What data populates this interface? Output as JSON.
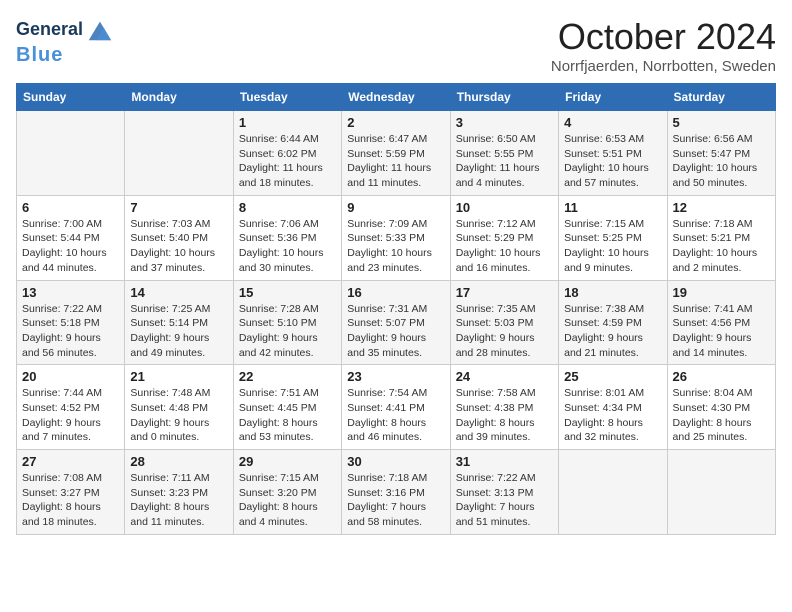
{
  "header": {
    "logo_line1": "General",
    "logo_line2": "Blue",
    "month": "October 2024",
    "location": "Norrfjaerden, Norrbotten, Sweden"
  },
  "weekdays": [
    "Sunday",
    "Monday",
    "Tuesday",
    "Wednesday",
    "Thursday",
    "Friday",
    "Saturday"
  ],
  "weeks": [
    [
      {
        "day": "",
        "info": ""
      },
      {
        "day": "",
        "info": ""
      },
      {
        "day": "1",
        "info": "Sunrise: 6:44 AM\nSunset: 6:02 PM\nDaylight: 11 hours and 18 minutes."
      },
      {
        "day": "2",
        "info": "Sunrise: 6:47 AM\nSunset: 5:59 PM\nDaylight: 11 hours and 11 minutes."
      },
      {
        "day": "3",
        "info": "Sunrise: 6:50 AM\nSunset: 5:55 PM\nDaylight: 11 hours and 4 minutes."
      },
      {
        "day": "4",
        "info": "Sunrise: 6:53 AM\nSunset: 5:51 PM\nDaylight: 10 hours and 57 minutes."
      },
      {
        "day": "5",
        "info": "Sunrise: 6:56 AM\nSunset: 5:47 PM\nDaylight: 10 hours and 50 minutes."
      }
    ],
    [
      {
        "day": "6",
        "info": "Sunrise: 7:00 AM\nSunset: 5:44 PM\nDaylight: 10 hours and 44 minutes."
      },
      {
        "day": "7",
        "info": "Sunrise: 7:03 AM\nSunset: 5:40 PM\nDaylight: 10 hours and 37 minutes."
      },
      {
        "day": "8",
        "info": "Sunrise: 7:06 AM\nSunset: 5:36 PM\nDaylight: 10 hours and 30 minutes."
      },
      {
        "day": "9",
        "info": "Sunrise: 7:09 AM\nSunset: 5:33 PM\nDaylight: 10 hours and 23 minutes."
      },
      {
        "day": "10",
        "info": "Sunrise: 7:12 AM\nSunset: 5:29 PM\nDaylight: 10 hours and 16 minutes."
      },
      {
        "day": "11",
        "info": "Sunrise: 7:15 AM\nSunset: 5:25 PM\nDaylight: 10 hours and 9 minutes."
      },
      {
        "day": "12",
        "info": "Sunrise: 7:18 AM\nSunset: 5:21 PM\nDaylight: 10 hours and 2 minutes."
      }
    ],
    [
      {
        "day": "13",
        "info": "Sunrise: 7:22 AM\nSunset: 5:18 PM\nDaylight: 9 hours and 56 minutes."
      },
      {
        "day": "14",
        "info": "Sunrise: 7:25 AM\nSunset: 5:14 PM\nDaylight: 9 hours and 49 minutes."
      },
      {
        "day": "15",
        "info": "Sunrise: 7:28 AM\nSunset: 5:10 PM\nDaylight: 9 hours and 42 minutes."
      },
      {
        "day": "16",
        "info": "Sunrise: 7:31 AM\nSunset: 5:07 PM\nDaylight: 9 hours and 35 minutes."
      },
      {
        "day": "17",
        "info": "Sunrise: 7:35 AM\nSunset: 5:03 PM\nDaylight: 9 hours and 28 minutes."
      },
      {
        "day": "18",
        "info": "Sunrise: 7:38 AM\nSunset: 4:59 PM\nDaylight: 9 hours and 21 minutes."
      },
      {
        "day": "19",
        "info": "Sunrise: 7:41 AM\nSunset: 4:56 PM\nDaylight: 9 hours and 14 minutes."
      }
    ],
    [
      {
        "day": "20",
        "info": "Sunrise: 7:44 AM\nSunset: 4:52 PM\nDaylight: 9 hours and 7 minutes."
      },
      {
        "day": "21",
        "info": "Sunrise: 7:48 AM\nSunset: 4:48 PM\nDaylight: 9 hours and 0 minutes."
      },
      {
        "day": "22",
        "info": "Sunrise: 7:51 AM\nSunset: 4:45 PM\nDaylight: 8 hours and 53 minutes."
      },
      {
        "day": "23",
        "info": "Sunrise: 7:54 AM\nSunset: 4:41 PM\nDaylight: 8 hours and 46 minutes."
      },
      {
        "day": "24",
        "info": "Sunrise: 7:58 AM\nSunset: 4:38 PM\nDaylight: 8 hours and 39 minutes."
      },
      {
        "day": "25",
        "info": "Sunrise: 8:01 AM\nSunset: 4:34 PM\nDaylight: 8 hours and 32 minutes."
      },
      {
        "day": "26",
        "info": "Sunrise: 8:04 AM\nSunset: 4:30 PM\nDaylight: 8 hours and 25 minutes."
      }
    ],
    [
      {
        "day": "27",
        "info": "Sunrise: 7:08 AM\nSunset: 3:27 PM\nDaylight: 8 hours and 18 minutes."
      },
      {
        "day": "28",
        "info": "Sunrise: 7:11 AM\nSunset: 3:23 PM\nDaylight: 8 hours and 11 minutes."
      },
      {
        "day": "29",
        "info": "Sunrise: 7:15 AM\nSunset: 3:20 PM\nDaylight: 8 hours and 4 minutes."
      },
      {
        "day": "30",
        "info": "Sunrise: 7:18 AM\nSunset: 3:16 PM\nDaylight: 7 hours and 58 minutes."
      },
      {
        "day": "31",
        "info": "Sunrise: 7:22 AM\nSunset: 3:13 PM\nDaylight: 7 hours and 51 minutes."
      },
      {
        "day": "",
        "info": ""
      },
      {
        "day": "",
        "info": ""
      }
    ]
  ]
}
